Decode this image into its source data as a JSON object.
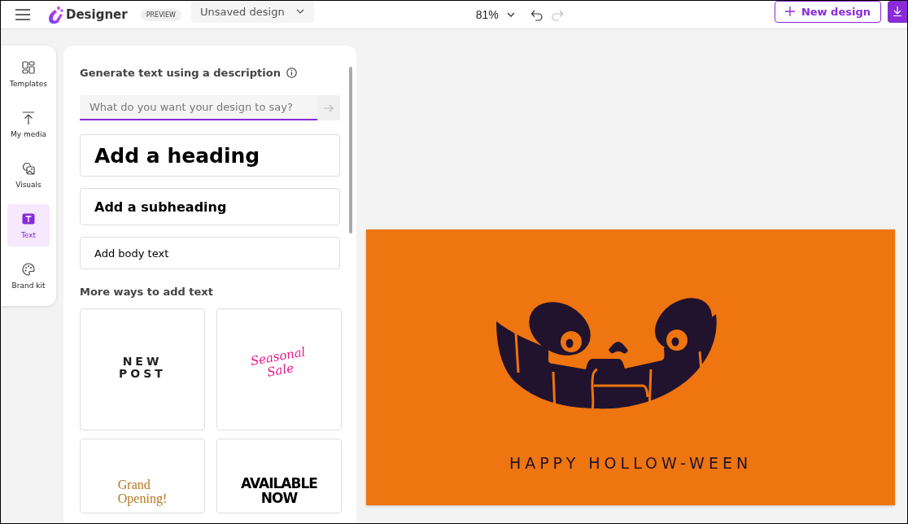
{
  "header": {
    "app_name": "Designer",
    "badge": "PREVIEW",
    "design_name": "Unsaved design",
    "zoom": "81%",
    "undo": {
      "disabled": false
    },
    "redo": {
      "disabled": true
    },
    "new_design": "New design"
  },
  "nav": [
    {
      "label": "Templates",
      "kind": "templates",
      "selected": false
    },
    {
      "label": "My media",
      "kind": "media",
      "selected": false
    },
    {
      "label": "Visuals",
      "kind": "visuals",
      "selected": false
    },
    {
      "label": "Text",
      "kind": "text",
      "selected": true
    },
    {
      "label": "Brand kit",
      "kind": "brand",
      "selected": false
    }
  ],
  "panel": {
    "prompt_title": "Generate text using a description",
    "prompt": {
      "placeholder": "What do you want your design to say?"
    },
    "text_styles": [
      {
        "kind": "heading",
        "label": "Add a heading"
      },
      {
        "kind": "subheading",
        "label": "Add a subheading"
      },
      {
        "kind": "body",
        "label": "Add body text"
      }
    ],
    "more_title": "More ways to add text",
    "samples": [
      {
        "kind": "spaced",
        "lines": [
          "NEW",
          "POST"
        ]
      },
      {
        "kind": "script",
        "lines": [
          "Seasonal",
          "Sale"
        ]
      },
      {
        "kind": "serif",
        "lines": [
          "Grand",
          "Opening!"
        ]
      },
      {
        "kind": "condensed",
        "lines": [
          "AVAILABLE",
          "NOW"
        ]
      }
    ]
  },
  "canvas": {
    "caption": "HAPPY HOLLOW-WEEN"
  }
}
